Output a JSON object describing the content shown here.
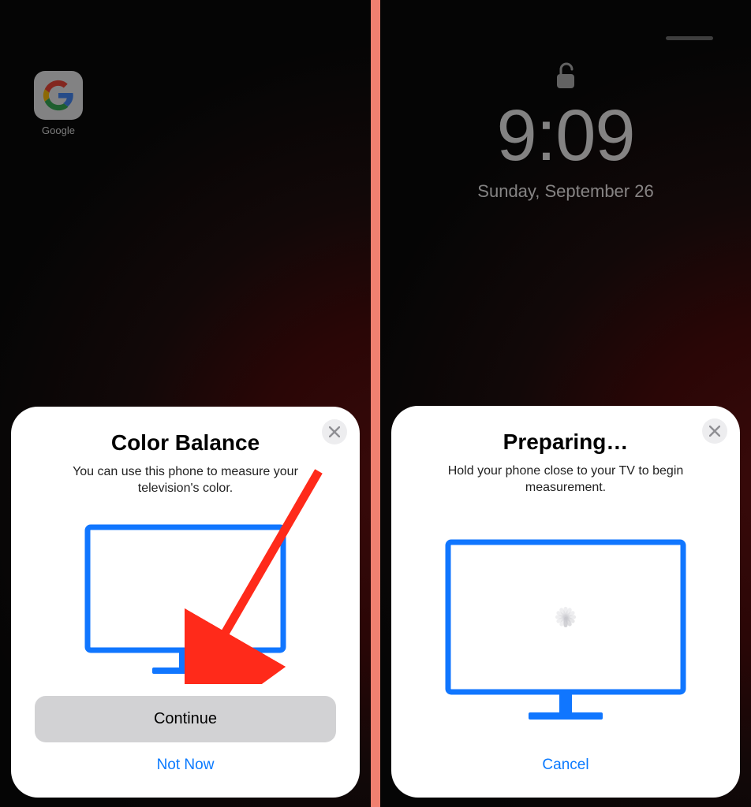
{
  "left": {
    "app": {
      "label": "Google"
    },
    "sheet": {
      "title": "Color Balance",
      "desc": "You can use this phone to measure your television's color.",
      "primary": "Continue",
      "secondary": "Not Now"
    }
  },
  "right": {
    "lock": {
      "time": "9:09",
      "date": "Sunday, September 26"
    },
    "sheet": {
      "title": "Preparing…",
      "desc": "Hold your phone close to your TV to begin measurement.",
      "secondary": "Cancel"
    }
  },
  "colors": {
    "accent": "#0a7aff",
    "tvStroke": "#1076ff"
  }
}
